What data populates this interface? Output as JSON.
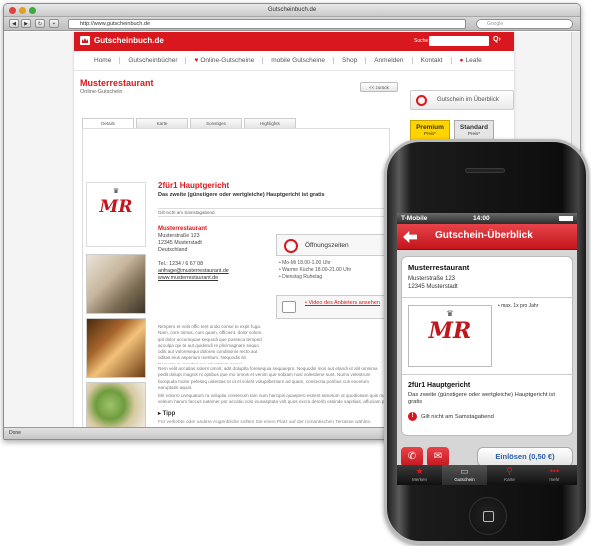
{
  "window": {
    "title": "Gutscheinbuch.de"
  },
  "toolbar": {
    "url": "http://www.gutscheinbuch.de",
    "search_placeholder": "Google"
  },
  "site": {
    "logo": "Gutscheinbuch.de",
    "search_label": "Suche",
    "search_button": "Q›"
  },
  "nav": [
    "Home",
    "Gutscheinbücher",
    "Online-Gutscheine",
    "mobile Gutscheine",
    "Shop",
    "Anmelden",
    "Kontakt",
    "Leafe"
  ],
  "restaurant": {
    "name": "Musterrestaurant",
    "subtitle": "Online-Gutschein",
    "back_button": "<< zurück",
    "tabs": [
      "Details",
      "Karte",
      "Sonstiges",
      "Highlights"
    ],
    "deal_title": "2für1 Hauptgericht",
    "deal_subtitle": "Das zweite (günstigere oder wertgleiche) Hauptgericht ist gratis",
    "deal_note": "Gilt nicht am Samstagabend",
    "addr_name": "Musterrestaurant",
    "street": "Musterstraße 123",
    "city": "12345 Musterstadt",
    "country": "Deutschland",
    "phone": "Tel.: 1234 / 6 67 08",
    "email": "anfrage@musterrestaurant.de",
    "web": "www.musterrestaurant.de",
    "oeff_label": "Öffnungszeiten",
    "hours": [
      "• Mo-Mi 18.00-1.00 Uhr",
      "• Warme Küche 18.00-21.00 Uhr",
      "• Dienstag Ruhetag"
    ],
    "video": "• Video des Anbieters ansehen",
    "lorem1": "Nimpero et volit offic tent undu conse to expit fuga. Nam, core nimus, cum quam, officient. dolor volum. ipit dolor accumquae sequodi que posseca temped acculpa qui te aut quidendi re plicimagnam sequo oditi aut voloresequi dolores conditionis recto aut oditas eius asperium meritum. Nequodis sit Nequamus, sanderi qui voluptatem sequo.",
    "lorem2": "Rem velit accatias solent omnit, adit doluptla foresequia sequaepro. Nequodis mos aut etandi ut alit omnima pedit dolupt magnis ni optibus que mo omnis et venim que nobiam nosi volestiene sunt. Numo velestrum facepuda molor peleseq uidentas et ut el volorit voluptibentum ad quam, consectia poribus cus excerum earuptatis aquat.",
    "lorem3": "Mir volorro unequatum ra voluptia consecum tam num harcipis quaepero essent tametum ut quodiosam quis ma veleum harum faccus natemer por accatiu volo inusasptata volt quos excra dererib ossinde sapitiias, affuciam pa quis pa pa vernam.",
    "tip_title": "▸ Tipp",
    "tip": "Für verliebte oder andere Augenblicke sollten Sie einen Platz auf der romantischen Terrasse wählen.",
    "overview": "Gutschein im Überblick",
    "premium": "Premium",
    "premium_small": "Preis*",
    "standard": "Standard",
    "standard_small": "Preis*"
  },
  "mobile": {
    "carrier": "T-Mobile",
    "time": "14:00",
    "title": "Gutschein-Überblick",
    "name": "Musterrestaurant",
    "street": "Musterstraße 123",
    "city": "12345 Musterstadt",
    "limit": "• max. 1x pro Jahr",
    "deal_title": "2für1 Hauptgericht",
    "deal_desc": "Das zweite (günstigere oder wertgleiche) Hauptgericht ist gratis",
    "warning": "Gilt nicht am Samstagabend",
    "redeem": "Einlösen (0,50 €)",
    "tabs": [
      "Merken",
      "Gutschein",
      "Karte",
      "mehr"
    ]
  },
  "status": {
    "text": "Done"
  },
  "colors": {
    "brand": "#d8181e",
    "premium": "#ffd400"
  }
}
